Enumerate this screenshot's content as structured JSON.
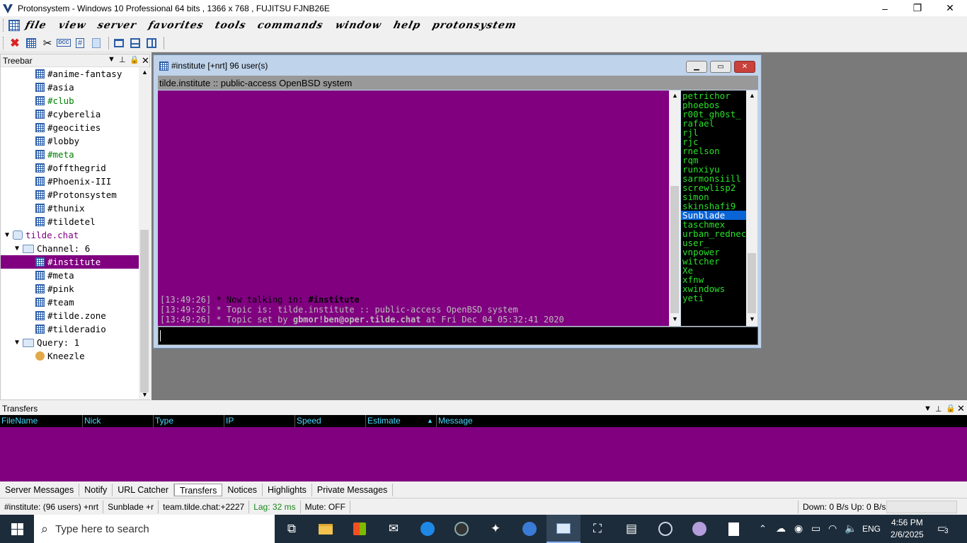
{
  "window": {
    "title": "Protonsystem - Windows 10 Professional 64 bits , 1366 x 768 , FUJITSU FJNB26E",
    "controls": [
      "–",
      "❐",
      "✕"
    ]
  },
  "menu": [
    "file",
    "view",
    "server",
    "favorites",
    "tools",
    "commands",
    "window",
    "help",
    "protonsystem"
  ],
  "toolbar_icons": [
    "disconnect-icon",
    "channel-list-icon",
    "options-icon",
    "dcc-icon",
    "channel-icon",
    "notes-icon",
    "cascade-icon",
    "tile-horizontal-icon",
    "tile-vertical-icon"
  ],
  "toolbar_labels": {
    "dcc": "DCC",
    "hash": "#"
  },
  "treebar": {
    "title": "Treebar",
    "items": [
      {
        "label": "#anime-fantasy",
        "kind": "channel",
        "color": "#000000"
      },
      {
        "label": "#asia",
        "kind": "channel",
        "color": "#000000"
      },
      {
        "label": "#club",
        "kind": "channel",
        "color": "#008000"
      },
      {
        "label": "#cyberelia",
        "kind": "channel",
        "color": "#000000"
      },
      {
        "label": "#geocities",
        "kind": "channel",
        "color": "#000000"
      },
      {
        "label": "#lobby",
        "kind": "channel",
        "color": "#000000"
      },
      {
        "label": "#meta",
        "kind": "channel",
        "color": "#008000"
      },
      {
        "label": "#offthegrid",
        "kind": "channel",
        "color": "#000000"
      },
      {
        "label": "#Phoenix-III",
        "kind": "channel",
        "color": "#000000"
      },
      {
        "label": "#Protonsystem",
        "kind": "channel",
        "color": "#000000"
      },
      {
        "label": "#thunix",
        "kind": "channel",
        "color": "#000000"
      },
      {
        "label": "#tildetel",
        "kind": "channel",
        "color": "#000000"
      },
      {
        "label": "tilde.chat",
        "kind": "server",
        "color": "#800080"
      },
      {
        "label": "Channel: 6",
        "kind": "folder",
        "color": "#000000"
      },
      {
        "label": "#institute",
        "kind": "channel-selected",
        "color": "#ffffff"
      },
      {
        "label": "#meta",
        "kind": "channel",
        "color": "#000000"
      },
      {
        "label": "#pink",
        "kind": "channel",
        "color": "#000000"
      },
      {
        "label": "#team",
        "kind": "channel",
        "color": "#000000"
      },
      {
        "label": "#tilde.zone",
        "kind": "channel",
        "color": "#000000"
      },
      {
        "label": "#tilderadio",
        "kind": "channel",
        "color": "#000000"
      },
      {
        "label": "Query: 1",
        "kind": "folder",
        "color": "#000000"
      },
      {
        "label": "Kneezle",
        "kind": "query",
        "color": "#000000"
      }
    ]
  },
  "channel_window": {
    "title": "#institute [+nrt] 96 user(s)",
    "topic": "tilde.institute :: public-access OpenBSD system",
    "lines": [
      {
        "time": "[13:49:26]",
        "prefix": " * Now talking in: ",
        "bold": "#institute",
        "rest": "",
        "color": "#000000"
      },
      {
        "time": "[13:49:26]",
        "prefix": " * Topic is: tilde.institute :: public-access OpenBSD system",
        "bold": "",
        "rest": "",
        "color": "#bbbbbb"
      },
      {
        "time": "[13:49:26]",
        "prefix": " * Topic set by ",
        "bold": "gbmor!ben@oper.tilde.chat",
        "rest": " at Fri Dec 04 05:32:41 2020",
        "color": "#bbbbbb"
      }
    ],
    "nicks": [
      "petrichor",
      "phoebos",
      "r00t_gh0st_",
      "rafael",
      "rjl",
      "rjc",
      "rnelson",
      "rqm",
      "runxiyu",
      "sarmonsiill",
      "screwlisp2",
      "simon",
      "skinshafi9",
      "Sunblade",
      "taschmex",
      "urban_redneck",
      "user_",
      "vnpower",
      "witcher",
      "Xe",
      "xfnw",
      "xwindows",
      "yeti"
    ],
    "selected_nick": "Sunblade"
  },
  "transfers": {
    "title": "Transfers",
    "columns": [
      "FileName",
      "Nick",
      "Type",
      "IP",
      "Speed",
      "Estimate",
      "Message"
    ]
  },
  "tabs": [
    "Server Messages",
    "Notify",
    "URL Catcher",
    "Transfers",
    "Notices",
    "Highlights",
    "Private Messages"
  ],
  "active_tab": "Transfers",
  "status": {
    "channel": "#institute: (96 users) +nrt",
    "nick": "Sunblade +r",
    "server": "team.tilde.chat:+2227",
    "lag": "Lag: 32 ms",
    "mute": "Mute: OFF",
    "speed": "Down: 0 B/s Up: 0 B/s"
  },
  "taskbar": {
    "search_placeholder": "Type here to search",
    "lang": "ENG",
    "time": "4:56 PM",
    "date": "2/6/2025",
    "notifications": "3"
  }
}
